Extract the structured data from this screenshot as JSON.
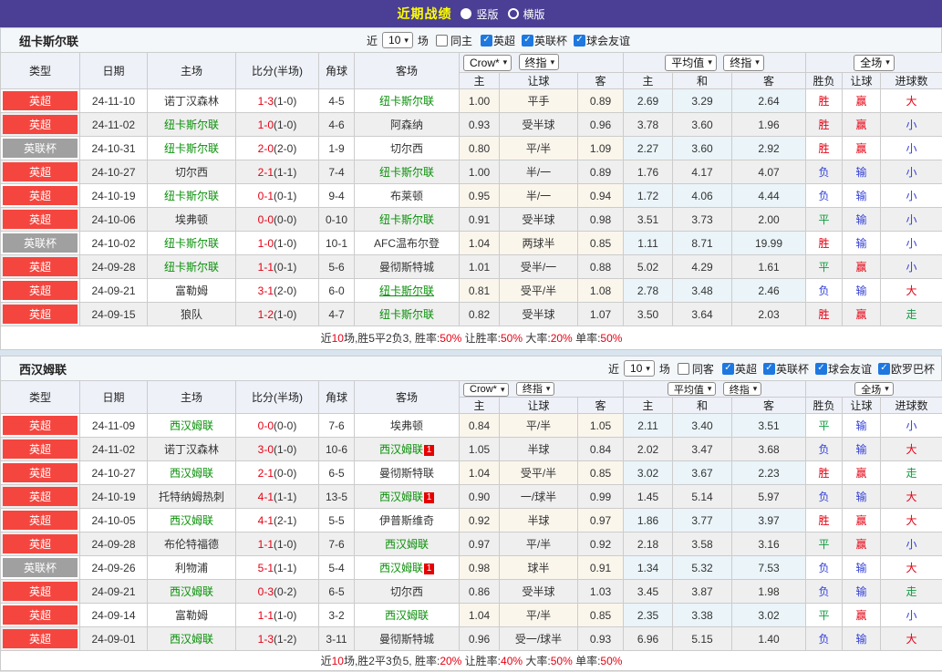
{
  "header": {
    "title": "近期战绩",
    "options": [
      {
        "label": "竖版",
        "selected": true
      },
      {
        "label": "横版",
        "selected": false
      }
    ]
  },
  "table_headers": {
    "left": [
      "类型",
      "日期",
      "主场",
      "比分(半场)",
      "角球",
      "客场"
    ],
    "sub": [
      "主",
      "让球",
      "客",
      "主",
      "和",
      "客",
      "胜负",
      "让球",
      "进球数"
    ]
  },
  "sections": [
    {
      "team": "纽卡斯尔联",
      "filter": {
        "prefix": "近",
        "count": "10",
        "suffix": "场",
        "same": "同主",
        "leagues": [
          "英超",
          "英联杯",
          "球会友谊"
        ]
      },
      "selects": {
        "company": "Crow*",
        "company_state": "终指",
        "average": "平均值",
        "average_state": "终指",
        "scope": "全场"
      },
      "rows": [
        {
          "lg": "英超",
          "lgc": "red",
          "date": "24-11-10",
          "home": {
            "n": "诺丁汉森林"
          },
          "ft": "1-3",
          "ht": "(1-0)",
          "cr": "4-5",
          "away": {
            "n": "纽卡斯尔联",
            "f": 1
          },
          "od": [
            "1.00",
            "平手",
            "0.89"
          ],
          "av": [
            "2.69",
            "3.29",
            "2.64"
          ],
          "rs": [
            [
              "胜",
              "r"
            ],
            [
              "赢",
              "r"
            ],
            [
              "大",
              "r"
            ]
          ]
        },
        {
          "lg": "英超",
          "lgc": "red",
          "date": "24-11-02",
          "home": {
            "n": "纽卡斯尔联",
            "f": 1
          },
          "ft": "1-0",
          "ht": "(1-0)",
          "cr": "4-6",
          "away": {
            "n": "阿森纳"
          },
          "od": [
            "0.93",
            "受半球",
            "0.96"
          ],
          "av": [
            "3.78",
            "3.60",
            "1.96"
          ],
          "rs": [
            [
              "胜",
              "r"
            ],
            [
              "赢",
              "r"
            ],
            [
              "小",
              "b"
            ]
          ]
        },
        {
          "lg": "英联杯",
          "lgc": "gray",
          "date": "24-10-31",
          "home": {
            "n": "纽卡斯尔联",
            "f": 1
          },
          "ft": "2-0",
          "ht": "(2-0)",
          "cr": "1-9",
          "away": {
            "n": "切尔西"
          },
          "od": [
            "0.80",
            "平/半",
            "1.09"
          ],
          "av": [
            "2.27",
            "3.60",
            "2.92"
          ],
          "rs": [
            [
              "胜",
              "r"
            ],
            [
              "赢",
              "r"
            ],
            [
              "小",
              "b"
            ]
          ]
        },
        {
          "lg": "英超",
          "lgc": "red",
          "date": "24-10-27",
          "home": {
            "n": "切尔西"
          },
          "ft": "2-1",
          "ht": "(1-1)",
          "cr": "7-4",
          "away": {
            "n": "纽卡斯尔联",
            "f": 1
          },
          "od": [
            "1.00",
            "半/一",
            "0.89"
          ],
          "av": [
            "1.76",
            "4.17",
            "4.07"
          ],
          "rs": [
            [
              "负",
              "b"
            ],
            [
              "输",
              "b"
            ],
            [
              "小",
              "b"
            ]
          ]
        },
        {
          "lg": "英超",
          "lgc": "red",
          "date": "24-10-19",
          "home": {
            "n": "纽卡斯尔联",
            "f": 1
          },
          "ft": "0-1",
          "ht": "(0-1)",
          "cr": "9-4",
          "away": {
            "n": "布莱顿"
          },
          "od": [
            "0.95",
            "半/一",
            "0.94"
          ],
          "av": [
            "1.72",
            "4.06",
            "4.44"
          ],
          "rs": [
            [
              "负",
              "b"
            ],
            [
              "输",
              "b"
            ],
            [
              "小",
              "b"
            ]
          ]
        },
        {
          "lg": "英超",
          "lgc": "red",
          "date": "24-10-06",
          "home": {
            "n": "埃弗顿"
          },
          "ft": "0-0",
          "ht": "(0-0)",
          "cr": "0-10",
          "away": {
            "n": "纽卡斯尔联",
            "f": 1
          },
          "od": [
            "0.91",
            "受半球",
            "0.98"
          ],
          "av": [
            "3.51",
            "3.73",
            "2.00"
          ],
          "rs": [
            [
              "平",
              "g"
            ],
            [
              "输",
              "b"
            ],
            [
              "小",
              "b"
            ]
          ]
        },
        {
          "lg": "英联杯",
          "lgc": "gray",
          "date": "24-10-02",
          "home": {
            "n": "纽卡斯尔联",
            "f": 1
          },
          "ft": "1-0",
          "ht": "(1-0)",
          "cr": "10-1",
          "away": {
            "n": "AFC温布尔登"
          },
          "od": [
            "1.04",
            "两球半",
            "0.85"
          ],
          "av": [
            "1.11",
            "8.71",
            "19.99"
          ],
          "rs": [
            [
              "胜",
              "r"
            ],
            [
              "输",
              "b"
            ],
            [
              "小",
              "b"
            ]
          ]
        },
        {
          "lg": "英超",
          "lgc": "red",
          "date": "24-09-28",
          "home": {
            "n": "纽卡斯尔联",
            "f": 1
          },
          "ft": "1-1",
          "ht": "(0-1)",
          "cr": "5-6",
          "away": {
            "n": "曼彻斯特城"
          },
          "od": [
            "1.01",
            "受半/一",
            "0.88"
          ],
          "av": [
            "5.02",
            "4.29",
            "1.61"
          ],
          "rs": [
            [
              "平",
              "g"
            ],
            [
              "赢",
              "r"
            ],
            [
              "小",
              "b"
            ]
          ]
        },
        {
          "lg": "英超",
          "lgc": "red",
          "date": "24-09-21",
          "home": {
            "n": "富勒姆"
          },
          "ft": "3-1",
          "ht": "(2-0)",
          "cr": "6-0",
          "away": {
            "n": "纽卡斯尔联",
            "f": 1,
            "u": 1
          },
          "od": [
            "0.81",
            "受平/半",
            "1.08"
          ],
          "av": [
            "2.78",
            "3.48",
            "2.46"
          ],
          "rs": [
            [
              "负",
              "b"
            ],
            [
              "输",
              "b"
            ],
            [
              "大",
              "r"
            ]
          ]
        },
        {
          "lg": "英超",
          "lgc": "red",
          "date": "24-09-15",
          "home": {
            "n": "狼队"
          },
          "ft": "1-2",
          "ht": "(1-0)",
          "cr": "4-7",
          "away": {
            "n": "纽卡斯尔联",
            "f": 1
          },
          "od": [
            "0.82",
            "受半球",
            "1.07"
          ],
          "av": [
            "3.50",
            "3.64",
            "2.03"
          ],
          "rs": [
            [
              "胜",
              "r"
            ],
            [
              "赢",
              "r"
            ],
            [
              "走",
              "g"
            ]
          ]
        }
      ],
      "summary": [
        [
          "近",
          "k"
        ],
        [
          "10",
          "r"
        ],
        [
          "场,胜5平2负3, 胜率:",
          "k"
        ],
        [
          "50%",
          "r"
        ],
        [
          " 让胜率:",
          "k"
        ],
        [
          "50%",
          "r"
        ],
        [
          " 大率:",
          "k"
        ],
        [
          "20%",
          "r"
        ],
        [
          " 单率:",
          "k"
        ],
        [
          "50%",
          "r"
        ]
      ]
    },
    {
      "team": "西汉姆联",
      "filter": {
        "prefix": "近",
        "count": "10",
        "suffix": "场",
        "same": "同客",
        "leagues": [
          "英超",
          "英联杯",
          "球会友谊",
          "欧罗巴杯"
        ]
      },
      "selects": {
        "company": "Crow*",
        "company_state": "终指",
        "average": "平均值",
        "average_state": "终指",
        "scope": "全场"
      },
      "rows": [
        {
          "lg": "英超",
          "lgc": "red",
          "date": "24-11-09",
          "home": {
            "n": "西汉姆联",
            "f": 1
          },
          "ft": "0-0",
          "ht": "(0-0)",
          "cr": "7-6",
          "away": {
            "n": "埃弗顿"
          },
          "od": [
            "0.84",
            "平/半",
            "1.05"
          ],
          "av": [
            "2.11",
            "3.40",
            "3.51"
          ],
          "rs": [
            [
              "平",
              "g"
            ],
            [
              "输",
              "b"
            ],
            [
              "小",
              "b"
            ]
          ]
        },
        {
          "lg": "英超",
          "lgc": "red",
          "date": "24-11-02",
          "home": {
            "n": "诺丁汉森林"
          },
          "ft": "3-0",
          "ht": "(1-0)",
          "cr": "10-6",
          "away": {
            "n": "西汉姆联",
            "f": 1,
            "rc": "1"
          },
          "od": [
            "1.05",
            "半球",
            "0.84"
          ],
          "av": [
            "2.02",
            "3.47",
            "3.68"
          ],
          "rs": [
            [
              "负",
              "b"
            ],
            [
              "输",
              "b"
            ],
            [
              "大",
              "r"
            ]
          ]
        },
        {
          "lg": "英超",
          "lgc": "red",
          "date": "24-10-27",
          "home": {
            "n": "西汉姆联",
            "f": 1
          },
          "ft": "2-1",
          "ht": "(0-0)",
          "cr": "6-5",
          "away": {
            "n": "曼彻斯特联"
          },
          "od": [
            "1.04",
            "受平/半",
            "0.85"
          ],
          "av": [
            "3.02",
            "3.67",
            "2.23"
          ],
          "rs": [
            [
              "胜",
              "r"
            ],
            [
              "赢",
              "r"
            ],
            [
              "走",
              "g"
            ]
          ]
        },
        {
          "lg": "英超",
          "lgc": "red",
          "date": "24-10-19",
          "home": {
            "n": "托特纳姆热刺"
          },
          "ft": "4-1",
          "ht": "(1-1)",
          "cr": "13-5",
          "away": {
            "n": "西汉姆联",
            "f": 1,
            "rc": "1"
          },
          "od": [
            "0.90",
            "一/球半",
            "0.99"
          ],
          "av": [
            "1.45",
            "5.14",
            "5.97"
          ],
          "rs": [
            [
              "负",
              "b"
            ],
            [
              "输",
              "b"
            ],
            [
              "大",
              "r"
            ]
          ]
        },
        {
          "lg": "英超",
          "lgc": "red",
          "date": "24-10-05",
          "home": {
            "n": "西汉姆联",
            "f": 1
          },
          "ft": "4-1",
          "ht": "(2-1)",
          "cr": "5-5",
          "away": {
            "n": "伊普斯维奇"
          },
          "od": [
            "0.92",
            "半球",
            "0.97"
          ],
          "av": [
            "1.86",
            "3.77",
            "3.97"
          ],
          "rs": [
            [
              "胜",
              "r"
            ],
            [
              "赢",
              "r"
            ],
            [
              "大",
              "r"
            ]
          ]
        },
        {
          "lg": "英超",
          "lgc": "red",
          "date": "24-09-28",
          "home": {
            "n": "布伦特福德"
          },
          "ft": "1-1",
          "ht": "(1-0)",
          "cr": "7-6",
          "away": {
            "n": "西汉姆联",
            "f": 1
          },
          "od": [
            "0.97",
            "平/半",
            "0.92"
          ],
          "av": [
            "2.18",
            "3.58",
            "3.16"
          ],
          "rs": [
            [
              "平",
              "g"
            ],
            [
              "赢",
              "r"
            ],
            [
              "小",
              "b"
            ]
          ]
        },
        {
          "lg": "英联杯",
          "lgc": "gray",
          "date": "24-09-26",
          "home": {
            "n": "利物浦"
          },
          "ft": "5-1",
          "ht": "(1-1)",
          "cr": "5-4",
          "away": {
            "n": "西汉姆联",
            "f": 1,
            "rc": "1"
          },
          "od": [
            "0.98",
            "球半",
            "0.91"
          ],
          "av": [
            "1.34",
            "5.32",
            "7.53"
          ],
          "rs": [
            [
              "负",
              "b"
            ],
            [
              "输",
              "b"
            ],
            [
              "大",
              "r"
            ]
          ]
        },
        {
          "lg": "英超",
          "lgc": "red",
          "date": "24-09-21",
          "home": {
            "n": "西汉姆联",
            "f": 1
          },
          "ft": "0-3",
          "ht": "(0-2)",
          "cr": "6-5",
          "away": {
            "n": "切尔西"
          },
          "od": [
            "0.86",
            "受半球",
            "1.03"
          ],
          "av": [
            "3.45",
            "3.87",
            "1.98"
          ],
          "rs": [
            [
              "负",
              "b"
            ],
            [
              "输",
              "b"
            ],
            [
              "走",
              "g"
            ]
          ]
        },
        {
          "lg": "英超",
          "lgc": "red",
          "date": "24-09-14",
          "home": {
            "n": "富勒姆"
          },
          "ft": "1-1",
          "ht": "(1-0)",
          "cr": "3-2",
          "away": {
            "n": "西汉姆联",
            "f": 1
          },
          "od": [
            "1.04",
            "平/半",
            "0.85"
          ],
          "av": [
            "2.35",
            "3.38",
            "3.02"
          ],
          "rs": [
            [
              "平",
              "g"
            ],
            [
              "赢",
              "r"
            ],
            [
              "小",
              "b"
            ]
          ]
        },
        {
          "lg": "英超",
          "lgc": "red",
          "date": "24-09-01",
          "home": {
            "n": "西汉姆联",
            "f": 1
          },
          "ft": "1-3",
          "ht": "(1-2)",
          "cr": "3-11",
          "away": {
            "n": "曼彻斯特城"
          },
          "od": [
            "0.96",
            "受一/球半",
            "0.93"
          ],
          "av": [
            "6.96",
            "5.15",
            "1.40"
          ],
          "rs": [
            [
              "负",
              "b"
            ],
            [
              "输",
              "b"
            ],
            [
              "大",
              "r"
            ]
          ]
        }
      ],
      "summary": [
        [
          "近",
          "k"
        ],
        [
          "10",
          "r"
        ],
        [
          "场,胜2平3负5, 胜率:",
          "k"
        ],
        [
          "20%",
          "r"
        ],
        [
          " 让胜率:",
          "k"
        ],
        [
          "40%",
          "r"
        ],
        [
          " 大率:",
          "k"
        ],
        [
          "50%",
          "r"
        ],
        [
          " 单率:",
          "k"
        ],
        [
          "50%",
          "r"
        ]
      ]
    }
  ]
}
